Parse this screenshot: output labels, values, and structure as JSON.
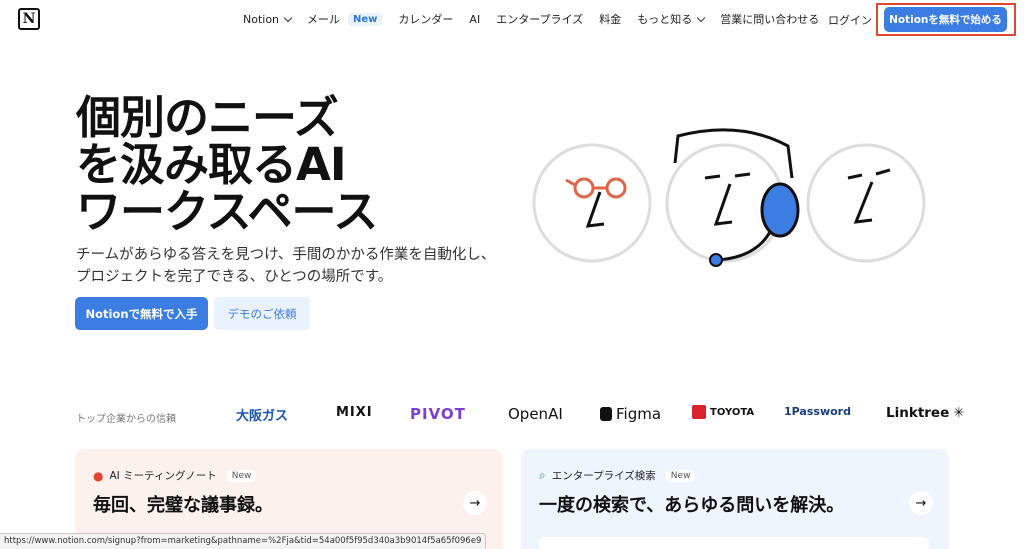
{
  "nav": {
    "logo_letter": "N",
    "items": [
      {
        "label": "Notion",
        "dropdown": true
      },
      {
        "label": "メール",
        "badge": "New"
      },
      {
        "label": "カレンダー"
      },
      {
        "label": "AI"
      },
      {
        "label": "エンタープライズ"
      },
      {
        "label": "料金"
      },
      {
        "label": "もっと知る",
        "dropdown": true
      },
      {
        "label": "営業に問い合わせる"
      }
    ],
    "login": "ログイン",
    "cta": "Notionを無料で始める"
  },
  "hero": {
    "title_lines": [
      "個別のニーズ",
      "を汲み取るAI",
      "ワークスペース"
    ],
    "subtitle": "チームがあらゆる答えを見つけ、手間のかかる作業を自動化し、プロジェクトを完了できる、ひとつの場所です。",
    "primary_button": "Notionで無料で入手",
    "secondary_button": "デモのご依頼"
  },
  "trusted": {
    "label": "トップ企業からの信頼",
    "logos": [
      "大阪ガス",
      "MIXI",
      "PIVOT",
      "OpenAI",
      "Figma",
      "TOYOTA",
      "1Password",
      "Linktree"
    ]
  },
  "cards": [
    {
      "tag": "AI ミーティングノート",
      "badge": "New",
      "title": "毎回、完璧な議事録。",
      "arrow": "→"
    },
    {
      "tag": "エンタープライズ検索",
      "badge": "New",
      "title": "一度の検索で、あらゆる問いを解決。",
      "arrow": "→"
    }
  ],
  "status_url": "https://www.notion.com/signup?from=marketing&pathname=%2Fja&tid=54a00f5f95d340a3b9014f5a65f096e9",
  "colors": {
    "accent": "#3b7de3",
    "highlight": "#e0492f",
    "card_left_bg": "#fdf1ee",
    "card_right_bg": "#eef5fd"
  }
}
